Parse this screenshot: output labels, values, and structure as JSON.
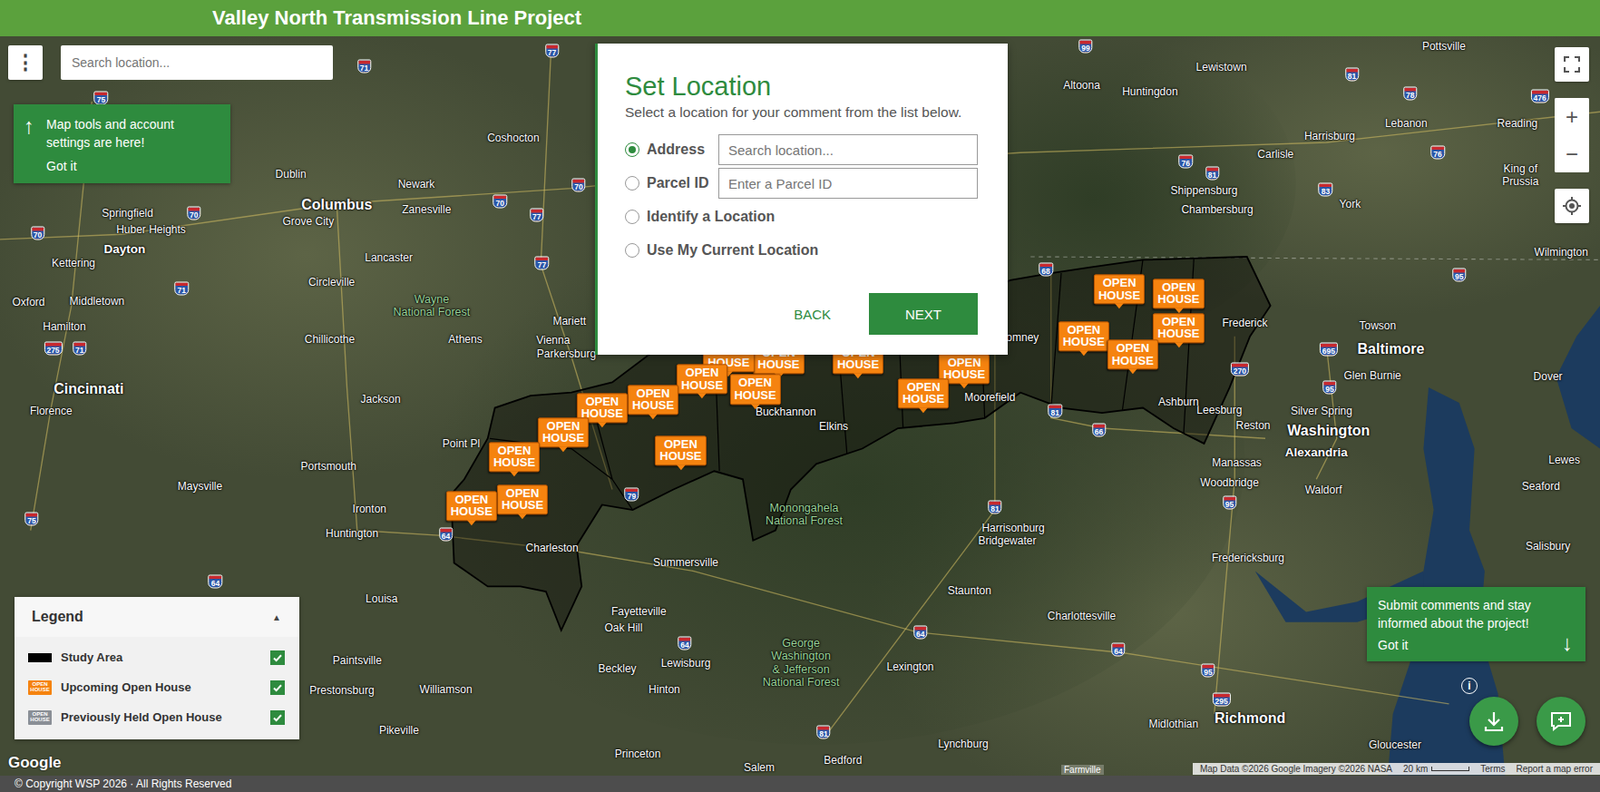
{
  "header": {
    "title": "Valley North Transmission Line Project"
  },
  "toolbar": {
    "menu_icon": "⋮",
    "search": {
      "placeholder": "Search location..."
    }
  },
  "tools_tip": {
    "arrow": "↑",
    "text": "Map tools and account settings are here!",
    "button": "Got it"
  },
  "map_controls": {
    "zoom_in": "+",
    "zoom_out": "−"
  },
  "dialog": {
    "title": "Set Location",
    "subtitle": "Select a location for your comment from the list below.",
    "options": [
      {
        "label": "Address",
        "selected": true,
        "placeholder": "Search location..."
      },
      {
        "label": "Parcel ID",
        "selected": false,
        "placeholder": "Enter a Parcel ID"
      },
      {
        "label": "Identify a Location",
        "selected": false
      },
      {
        "label": "Use My Current Location",
        "selected": false
      }
    ],
    "buttons": {
      "back": "BACK",
      "next": "NEXT"
    }
  },
  "legend": {
    "title": "Legend",
    "caret": "▲",
    "expanded": true,
    "items": [
      {
        "label": "Study Area",
        "kind": "area",
        "checked": true
      },
      {
        "label": "Upcoming Open House",
        "kind": "upcoming",
        "icon_text": "OPEN HOUSE",
        "checked": true
      },
      {
        "label": "Previously Held Open House",
        "kind": "previous",
        "icon_text": "OPEN HOUSE",
        "checked": true
      }
    ]
  },
  "comment_tip": {
    "text": "Submit comments and stay informed about the project!",
    "button": "Got it",
    "arrow": "↓"
  },
  "info_icon": "i",
  "map": {
    "open_houses": [
      {
        "label": "OPEN HOUSE",
        "status": "upcoming"
      },
      {
        "label": "OPEN HOUSE",
        "status": "upcoming"
      },
      {
        "label": "OPEN HOUSE",
        "status": "upcoming"
      },
      {
        "label": "OPEN HOUSE",
        "status": "upcoming"
      },
      {
        "label": "OPEN HOUSE",
        "status": "upcoming"
      },
      {
        "label": "OPEN HOUSE",
        "status": "upcoming"
      },
      {
        "label": "OPEN HOUSE",
        "status": "upcoming"
      },
      {
        "label": "OPEN HOUSE",
        "status": "upcoming"
      },
      {
        "label": "OPEN HOUSE",
        "status": "upcoming"
      },
      {
        "label": "OPEN HOUSE",
        "status": "upcoming"
      },
      {
        "label": "OPEN HOUSE",
        "status": "upcoming"
      },
      {
        "label": "OPEN HOUSE",
        "status": "upcoming"
      },
      {
        "label": "OPEN HOUSE",
        "status": "upcoming"
      },
      {
        "label": "OPEN HOUSE",
        "status": "upcoming"
      },
      {
        "label": "OPEN HOUSE",
        "status": "upcoming"
      },
      {
        "label": "OPEN HOUSE",
        "status": "upcoming"
      },
      {
        "label": "OPEN HOUSE",
        "status": "upcoming"
      },
      {
        "label": "OPEN HOUSE",
        "status": "upcoming"
      },
      {
        "label": "OPEN HOUSE",
        "status": "upcoming"
      }
    ],
    "labels": [
      {
        "text": "Columbus",
        "kind": "major"
      },
      {
        "text": "Cincinnati",
        "kind": "major"
      },
      {
        "text": "Washington",
        "kind": "major"
      },
      {
        "text": "Baltimore",
        "kind": "major"
      },
      {
        "text": "Richmond",
        "kind": "major"
      },
      {
        "text": "Dayton",
        "kind": "large"
      },
      {
        "text": "Alexandria",
        "kind": "large"
      },
      {
        "text": "Springfield",
        "kind": "city"
      },
      {
        "text": "Huber Heights",
        "kind": "city"
      },
      {
        "text": "Kettering",
        "kind": "city"
      },
      {
        "text": "Middletown",
        "kind": "city"
      },
      {
        "text": "Oxford",
        "kind": "city"
      },
      {
        "text": "Hamilton",
        "kind": "city"
      },
      {
        "text": "Florence",
        "kind": "city"
      },
      {
        "text": "Dublin",
        "kind": "city"
      },
      {
        "text": "Grove City",
        "kind": "city"
      },
      {
        "text": "Newark",
        "kind": "city"
      },
      {
        "text": "Zanesville",
        "kind": "city"
      },
      {
        "text": "Coshocton",
        "kind": "city"
      },
      {
        "text": "Lancaster",
        "kind": "city"
      },
      {
        "text": "Circleville",
        "kind": "city"
      },
      {
        "text": "Chillicothe",
        "kind": "city"
      },
      {
        "text": "Athens",
        "kind": "city"
      },
      {
        "text": "Mariett",
        "kind": "city"
      },
      {
        "text": "Vienna",
        "kind": "city"
      },
      {
        "text": "Parkersburg",
        "kind": "city"
      },
      {
        "text": "Jackson",
        "kind": "city"
      },
      {
        "text": "Portsmouth",
        "kind": "city"
      },
      {
        "text": "Point Pl",
        "kind": "city"
      },
      {
        "text": "Maysville",
        "kind": "city"
      },
      {
        "text": "Ironton",
        "kind": "city"
      },
      {
        "text": "Huntington",
        "kind": "city"
      },
      {
        "text": "Charleston",
        "kind": "city"
      },
      {
        "text": "Summersville",
        "kind": "city"
      },
      {
        "text": "Fayetteville",
        "kind": "city"
      },
      {
        "text": "Oak Hill",
        "kind": "city"
      },
      {
        "text": "Beckley",
        "kind": "city"
      },
      {
        "text": "Lewisburg",
        "kind": "city"
      },
      {
        "text": "Hinton",
        "kind": "city"
      },
      {
        "text": "Louisa",
        "kind": "city"
      },
      {
        "text": "Paintsville",
        "kind": "city"
      },
      {
        "text": "Prestonsburg",
        "kind": "city"
      },
      {
        "text": "Williamson",
        "kind": "city"
      },
      {
        "text": "Pikeville",
        "kind": "city"
      },
      {
        "text": "Princeton",
        "kind": "city"
      },
      {
        "text": "Salem",
        "kind": "city"
      },
      {
        "text": "Bedford",
        "kind": "city"
      },
      {
        "text": "Lynchburg",
        "kind": "city"
      },
      {
        "text": "Lexington",
        "kind": "city"
      },
      {
        "text": "Staunton",
        "kind": "city"
      },
      {
        "text": "Charlottesville",
        "kind": "city"
      },
      {
        "text": "Harrisonburg",
        "kind": "city"
      },
      {
        "text": "Bridgewater",
        "kind": "city"
      },
      {
        "text": "Elkins",
        "kind": "city"
      },
      {
        "text": "Buckhannon",
        "kind": "city"
      },
      {
        "text": "Moorefield",
        "kind": "city"
      },
      {
        "text": "Leesburg",
        "kind": "city"
      },
      {
        "text": "Ashburn",
        "kind": "city"
      },
      {
        "text": "Reston",
        "kind": "city"
      },
      {
        "text": "Frederick",
        "kind": "city"
      },
      {
        "text": "Manassas",
        "kind": "city"
      },
      {
        "text": "Silver Spring",
        "kind": "city"
      },
      {
        "text": "Glen Burnie",
        "kind": "city"
      },
      {
        "text": "Towson",
        "kind": "city"
      },
      {
        "text": "Woodbridge",
        "kind": "city"
      },
      {
        "text": "Waldorf",
        "kind": "city"
      },
      {
        "text": "Fredericksburg",
        "kind": "city"
      },
      {
        "text": "Midlothian",
        "kind": "city"
      },
      {
        "text": "Gloucester",
        "kind": "city"
      },
      {
        "text": "Salisbury",
        "kind": "city"
      },
      {
        "text": "Seaford",
        "kind": "city"
      },
      {
        "text": "Lewes",
        "kind": "city"
      },
      {
        "text": "Dover",
        "kind": "city"
      },
      {
        "text": "Wilmington",
        "kind": "city"
      },
      {
        "text": "Reading",
        "kind": "city"
      },
      {
        "text": "Lebanon",
        "kind": "city"
      },
      {
        "text": "Harrisburg",
        "kind": "city"
      },
      {
        "text": "Carlisle",
        "kind": "city"
      },
      {
        "text": "Shippensburg",
        "kind": "city"
      },
      {
        "text": "Chambersburg",
        "kind": "city"
      },
      {
        "text": "York",
        "kind": "city"
      },
      {
        "text": "Altoona",
        "kind": "city"
      },
      {
        "text": "Huntingdon",
        "kind": "city"
      },
      {
        "text": "Lewistown",
        "kind": "city"
      },
      {
        "text": "Pottsville",
        "kind": "city"
      },
      {
        "text": "King of\nPrussia",
        "kind": "city"
      },
      {
        "text": "omney",
        "kind": "city"
      },
      {
        "text": "Wayne\nNational Forest",
        "kind": "park"
      },
      {
        "text": "Monongahela\nNational Forest",
        "kind": "park"
      },
      {
        "text": "George\nWashington\n& Jefferson\nNational Forest",
        "kind": "park"
      }
    ],
    "shields": [
      {
        "number": "71"
      },
      {
        "number": "77"
      },
      {
        "number": "75"
      },
      {
        "number": "70"
      },
      {
        "number": "70"
      },
      {
        "number": "71"
      },
      {
        "number": "275"
      },
      {
        "number": "71"
      },
      {
        "number": "70"
      },
      {
        "number": "77"
      },
      {
        "number": "70"
      },
      {
        "number": "77"
      },
      {
        "number": "64"
      },
      {
        "number": "64"
      },
      {
        "number": "75"
      },
      {
        "number": "79"
      },
      {
        "number": "64"
      },
      {
        "number": "64"
      },
      {
        "number": "64"
      },
      {
        "number": "81"
      },
      {
        "number": "81"
      },
      {
        "number": "95"
      },
      {
        "number": "95"
      },
      {
        "number": "295"
      },
      {
        "number": "66"
      },
      {
        "number": "81"
      },
      {
        "number": "68"
      },
      {
        "number": "99"
      },
      {
        "number": "76"
      },
      {
        "number": "81"
      },
      {
        "number": "83"
      },
      {
        "number": "76"
      },
      {
        "number": "78"
      },
      {
        "number": "81"
      },
      {
        "number": "476"
      },
      {
        "number": "95"
      },
      {
        "number": "695"
      },
      {
        "number": "270"
      },
      {
        "number": "95"
      }
    ]
  },
  "attribution": {
    "place": "Farmville",
    "data": "Map Data ©2026 Google Imagery ©2026 NASA",
    "scale": "20 km",
    "terms": "Terms",
    "report": "Report a map error"
  },
  "google_logo": "Google",
  "footer": "© Copyright WSP 2026 · All Rights Reserved"
}
